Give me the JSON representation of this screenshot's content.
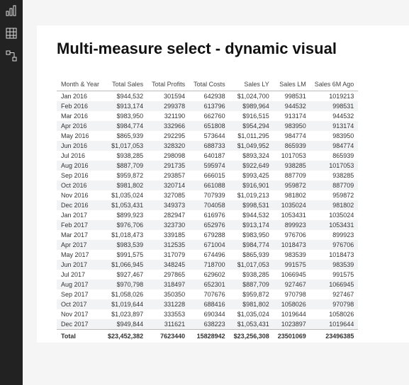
{
  "title": "Multi-measure select - dynamic visual",
  "sidebar": {
    "items": [
      "chart-view",
      "table-view",
      "relationship-view"
    ]
  },
  "table": {
    "headers": [
      "Month & Year",
      "Total Sales",
      "Total Profits",
      "Total Costs",
      "Sales LY",
      "Sales LM",
      "Sales 6M Ago"
    ],
    "rows": [
      [
        "Jan 2016",
        "$944,532",
        "301594",
        "642938",
        "$1,024,700",
        "998531",
        "1019213"
      ],
      [
        "Feb 2016",
        "$913,174",
        "299378",
        "613796",
        "$989,964",
        "944532",
        "998531"
      ],
      [
        "Mar 2016",
        "$983,950",
        "321190",
        "662760",
        "$916,515",
        "913174",
        "944532"
      ],
      [
        "Apr 2016",
        "$984,774",
        "332966",
        "651808",
        "$954,294",
        "983950",
        "913174"
      ],
      [
        "May 2016",
        "$865,939",
        "292295",
        "573644",
        "$1,011,295",
        "984774",
        "983950"
      ],
      [
        "Jun 2016",
        "$1,017,053",
        "328320",
        "688733",
        "$1,049,952",
        "865939",
        "984774"
      ],
      [
        "Jul 2016",
        "$938,285",
        "298098",
        "640187",
        "$893,324",
        "1017053",
        "865939"
      ],
      [
        "Aug 2016",
        "$887,709",
        "291735",
        "595974",
        "$922,649",
        "938285",
        "1017053"
      ],
      [
        "Sep 2016",
        "$959,872",
        "293857",
        "666015",
        "$993,425",
        "887709",
        "938285"
      ],
      [
        "Oct 2016",
        "$981,802",
        "320714",
        "661088",
        "$916,901",
        "959872",
        "887709"
      ],
      [
        "Nov 2016",
        "$1,035,024",
        "327085",
        "707939",
        "$1,019,213",
        "981802",
        "959872"
      ],
      [
        "Dec 2016",
        "$1,053,431",
        "349373",
        "704058",
        "$998,531",
        "1035024",
        "981802"
      ],
      [
        "Jan 2017",
        "$899,923",
        "282947",
        "616976",
        "$944,532",
        "1053431",
        "1035024"
      ],
      [
        "Feb 2017",
        "$976,706",
        "323730",
        "652976",
        "$913,174",
        "899923",
        "1053431"
      ],
      [
        "Mar 2017",
        "$1,018,473",
        "339185",
        "679288",
        "$983,950",
        "976706",
        "899923"
      ],
      [
        "Apr 2017",
        "$983,539",
        "312535",
        "671004",
        "$984,774",
        "1018473",
        "976706"
      ],
      [
        "May 2017",
        "$991,575",
        "317079",
        "674496",
        "$865,939",
        "983539",
        "1018473"
      ],
      [
        "Jun 2017",
        "$1,066,945",
        "348245",
        "718700",
        "$1,017,053",
        "991575",
        "983539"
      ],
      [
        "Jul 2017",
        "$927,467",
        "297865",
        "629602",
        "$938,285",
        "1066945",
        "991575"
      ],
      [
        "Aug 2017",
        "$970,798",
        "318497",
        "652301",
        "$887,709",
        "927467",
        "1066945"
      ],
      [
        "Sep 2017",
        "$1,058,026",
        "350350",
        "707676",
        "$959,872",
        "970798",
        "927467"
      ],
      [
        "Oct 2017",
        "$1,019,644",
        "331228",
        "688416",
        "$981,802",
        "1058026",
        "970798"
      ],
      [
        "Nov 2017",
        "$1,023,897",
        "333553",
        "690344",
        "$1,035,024",
        "1019644",
        "1058026"
      ],
      [
        "Dec 2017",
        "$949,844",
        "311621",
        "638223",
        "$1,053,431",
        "1023897",
        "1019644"
      ]
    ],
    "total": [
      "Total",
      "$23,452,382",
      "7623440",
      "15828942",
      "$23,256,308",
      "23501069",
      "23496385"
    ]
  },
  "chart_data": {
    "type": "table",
    "title": "Multi-measure select - dynamic visual",
    "columns": [
      "Month & Year",
      "Total Sales",
      "Total Profits",
      "Total Costs",
      "Sales LY",
      "Sales LM",
      "Sales 6M Ago"
    ],
    "rows": [
      {
        "month": "Jan 2016",
        "total_sales": 944532,
        "total_profits": 301594,
        "total_costs": 642938,
        "sales_ly": 1024700,
        "sales_lm": 998531,
        "sales_6m_ago": 1019213
      },
      {
        "month": "Feb 2016",
        "total_sales": 913174,
        "total_profits": 299378,
        "total_costs": 613796,
        "sales_ly": 989964,
        "sales_lm": 944532,
        "sales_6m_ago": 998531
      },
      {
        "month": "Mar 2016",
        "total_sales": 983950,
        "total_profits": 321190,
        "total_costs": 662760,
        "sales_ly": 916515,
        "sales_lm": 913174,
        "sales_6m_ago": 944532
      },
      {
        "month": "Apr 2016",
        "total_sales": 984774,
        "total_profits": 332966,
        "total_costs": 651808,
        "sales_ly": 954294,
        "sales_lm": 983950,
        "sales_6m_ago": 913174
      },
      {
        "month": "May 2016",
        "total_sales": 865939,
        "total_profits": 292295,
        "total_costs": 573644,
        "sales_ly": 1011295,
        "sales_lm": 984774,
        "sales_6m_ago": 983950
      },
      {
        "month": "Jun 2016",
        "total_sales": 1017053,
        "total_profits": 328320,
        "total_costs": 688733,
        "sales_ly": 1049952,
        "sales_lm": 865939,
        "sales_6m_ago": 984774
      },
      {
        "month": "Jul 2016",
        "total_sales": 938285,
        "total_profits": 298098,
        "total_costs": 640187,
        "sales_ly": 893324,
        "sales_lm": 1017053,
        "sales_6m_ago": 865939
      },
      {
        "month": "Aug 2016",
        "total_sales": 887709,
        "total_profits": 291735,
        "total_costs": 595974,
        "sales_ly": 922649,
        "sales_lm": 938285,
        "sales_6m_ago": 1017053
      },
      {
        "month": "Sep 2016",
        "total_sales": 959872,
        "total_profits": 293857,
        "total_costs": 666015,
        "sales_ly": 993425,
        "sales_lm": 887709,
        "sales_6m_ago": 938285
      },
      {
        "month": "Oct 2016",
        "total_sales": 981802,
        "total_profits": 320714,
        "total_costs": 661088,
        "sales_ly": 916901,
        "sales_lm": 959872,
        "sales_6m_ago": 887709
      },
      {
        "month": "Nov 2016",
        "total_sales": 1035024,
        "total_profits": 327085,
        "total_costs": 707939,
        "sales_ly": 1019213,
        "sales_lm": 981802,
        "sales_6m_ago": 959872
      },
      {
        "month": "Dec 2016",
        "total_sales": 1053431,
        "total_profits": 349373,
        "total_costs": 704058,
        "sales_ly": 998531,
        "sales_lm": 1035024,
        "sales_6m_ago": 981802
      },
      {
        "month": "Jan 2017",
        "total_sales": 899923,
        "total_profits": 282947,
        "total_costs": 616976,
        "sales_ly": 944532,
        "sales_lm": 1053431,
        "sales_6m_ago": 1035024
      },
      {
        "month": "Feb 2017",
        "total_sales": 976706,
        "total_profits": 323730,
        "total_costs": 652976,
        "sales_ly": 913174,
        "sales_lm": 899923,
        "sales_6m_ago": 1053431
      },
      {
        "month": "Mar 2017",
        "total_sales": 1018473,
        "total_profits": 339185,
        "total_costs": 679288,
        "sales_ly": 983950,
        "sales_lm": 976706,
        "sales_6m_ago": 899923
      },
      {
        "month": "Apr 2017",
        "total_sales": 983539,
        "total_profits": 312535,
        "total_costs": 671004,
        "sales_ly": 984774,
        "sales_lm": 1018473,
        "sales_6m_ago": 976706
      },
      {
        "month": "May 2017",
        "total_sales": 991575,
        "total_profits": 317079,
        "total_costs": 674496,
        "sales_ly": 865939,
        "sales_lm": 983539,
        "sales_6m_ago": 1018473
      },
      {
        "month": "Jun 2017",
        "total_sales": 1066945,
        "total_profits": 348245,
        "total_costs": 718700,
        "sales_ly": 1017053,
        "sales_lm": 991575,
        "sales_6m_ago": 983539
      },
      {
        "month": "Jul 2017",
        "total_sales": 927467,
        "total_profits": 297865,
        "total_costs": 629602,
        "sales_ly": 938285,
        "sales_lm": 1066945,
        "sales_6m_ago": 991575
      },
      {
        "month": "Aug 2017",
        "total_sales": 970798,
        "total_profits": 318497,
        "total_costs": 652301,
        "sales_ly": 887709,
        "sales_lm": 927467,
        "sales_6m_ago": 1066945
      },
      {
        "month": "Sep 2017",
        "total_sales": 1058026,
        "total_profits": 350350,
        "total_costs": 707676,
        "sales_ly": 959872,
        "sales_lm": 970798,
        "sales_6m_ago": 927467
      },
      {
        "month": "Oct 2017",
        "total_sales": 1019644,
        "total_profits": 331228,
        "total_costs": 688416,
        "sales_ly": 981802,
        "sales_lm": 1058026,
        "sales_6m_ago": 970798
      },
      {
        "month": "Nov 2017",
        "total_sales": 1023897,
        "total_profits": 333553,
        "total_costs": 690344,
        "sales_ly": 1035024,
        "sales_lm": 1019644,
        "sales_6m_ago": 1058026
      },
      {
        "month": "Dec 2017",
        "total_sales": 949844,
        "total_profits": 311621,
        "total_costs": 638223,
        "sales_ly": 1053431,
        "sales_lm": 1023897,
        "sales_6m_ago": 1019644
      }
    ],
    "totals": {
      "total_sales": 23452382,
      "total_profits": 7623440,
      "total_costs": 15828942,
      "sales_ly": 23256308,
      "sales_lm": 23501069,
      "sales_6m_ago": 23496385
    }
  }
}
